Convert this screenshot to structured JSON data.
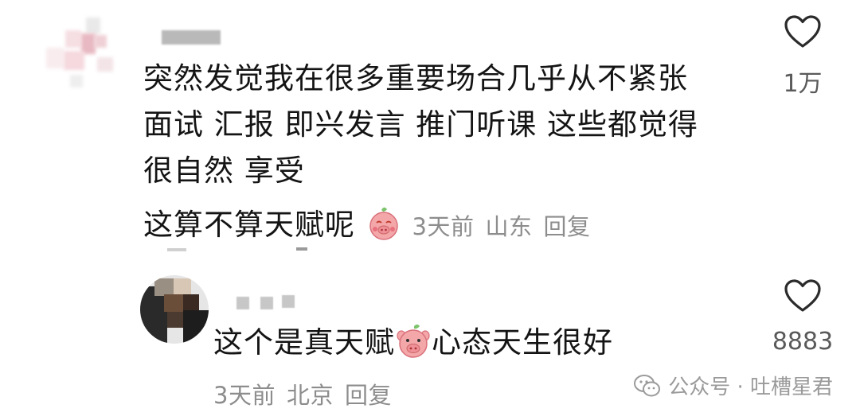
{
  "comment1": {
    "lines": [
      "突然发觉我在很多重要场合几乎从不紧张",
      "面试 汇报 即兴发言 推门听课 这些都觉得",
      "很自然 享受",
      "这算不算天赋呢"
    ],
    "time": "3天前",
    "location": "山东",
    "reply_label": "回复",
    "likes": "1万"
  },
  "comment2": {
    "text_before": "这个是真天赋",
    "text_after": "心态天生很好",
    "time": "3天前",
    "location": "北京",
    "reply_label": "回复",
    "likes": "8883"
  },
  "watermark": {
    "text": "公众号 · 吐槽星君"
  },
  "icons": {
    "like": "heart-outline-icon",
    "emoji": "pig-face-emoji-icon",
    "watermark_logo": "wechat-icon"
  },
  "colors": {
    "text": "#141414",
    "meta": "#8d8d8d",
    "likes": "#5a5a5a",
    "pig_skin": "#f4a7a9"
  }
}
